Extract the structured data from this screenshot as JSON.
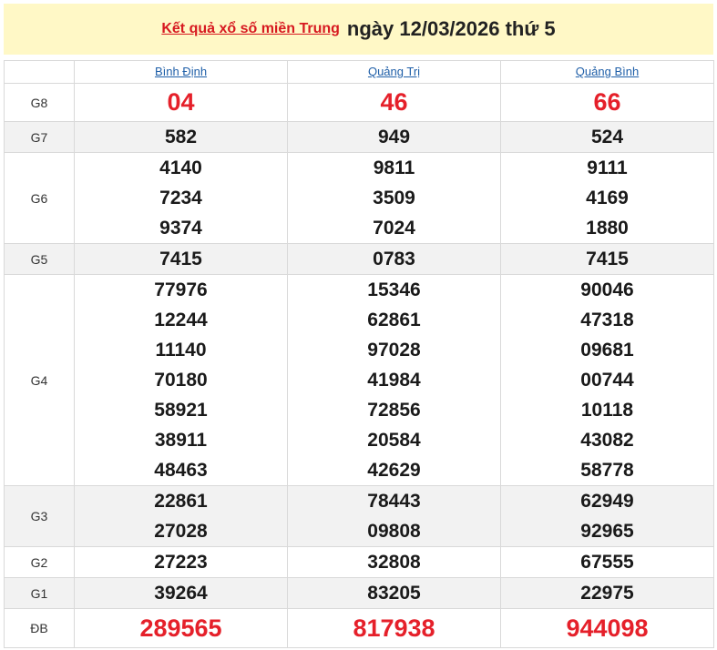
{
  "header": {
    "link_text": "Kết quả xổ số miền Trung",
    "date_text": "ngày 12/03/2026 thứ 5"
  },
  "provinces": [
    "Bình Định",
    "Quảng Trị",
    "Quảng Bình"
  ],
  "prizes": {
    "G8": {
      "label": "G8",
      "values": [
        "04",
        "46",
        "66"
      ]
    },
    "G7": {
      "label": "G7",
      "values": [
        "582",
        "949",
        "524"
      ]
    },
    "G6": {
      "label": "G6",
      "values": [
        [
          "4140",
          "7234",
          "9374"
        ],
        [
          "9811",
          "3509",
          "7024"
        ],
        [
          "9111",
          "4169",
          "1880"
        ]
      ]
    },
    "G5": {
      "label": "G5",
      "values": [
        "7415",
        "0783",
        "7415"
      ]
    },
    "G4": {
      "label": "G4",
      "values": [
        [
          "77976",
          "12244",
          "11140",
          "70180",
          "58921",
          "38911",
          "48463"
        ],
        [
          "15346",
          "62861",
          "97028",
          "41984",
          "72856",
          "20584",
          "42629"
        ],
        [
          "90046",
          "47318",
          "09681",
          "00744",
          "10118",
          "43082",
          "58778"
        ]
      ]
    },
    "G3": {
      "label": "G3",
      "values": [
        [
          "22861",
          "27028"
        ],
        [
          "78443",
          "09808"
        ],
        [
          "62949",
          "92965"
        ]
      ]
    },
    "G2": {
      "label": "G2",
      "values": [
        "27223",
        "32808",
        "67555"
      ]
    },
    "G1": {
      "label": "G1",
      "values": [
        "39264",
        "83205",
        "22975"
      ]
    },
    "DB": {
      "label": "ĐB",
      "values": [
        "289565",
        "817938",
        "944098"
      ]
    }
  },
  "colors": {
    "header_bg": "#fff8c6",
    "link_red": "#d71920",
    "highlight_red": "#e5202a",
    "province_blue": "#1f5fa8",
    "alt_row": "#f2f2f2"
  }
}
